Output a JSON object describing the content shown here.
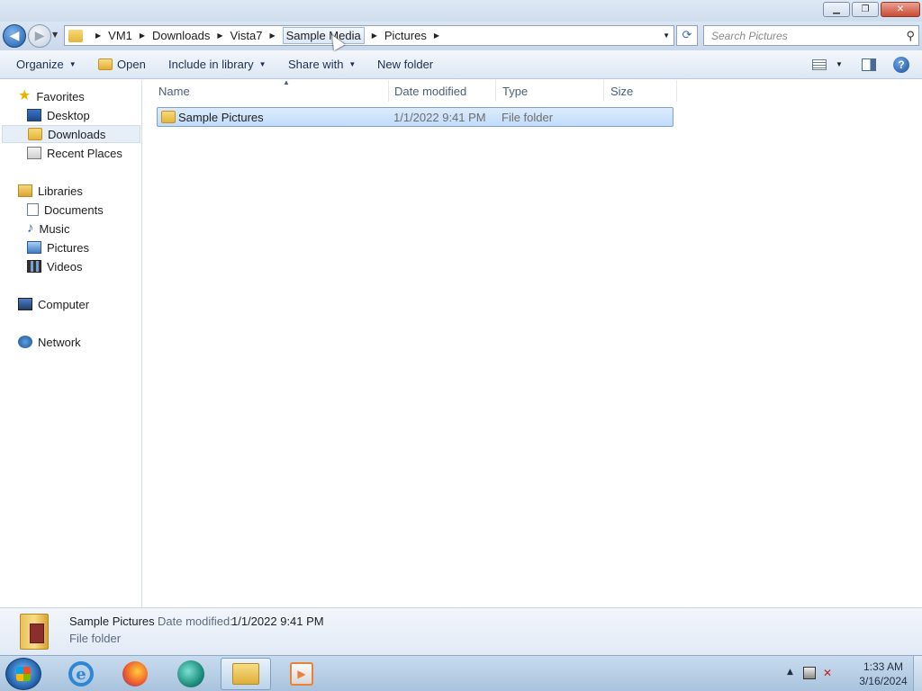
{
  "window": {
    "minimize_icon": "minimize-icon",
    "maximize_icon": "restore-icon",
    "close_icon": "close-icon"
  },
  "navigation": {
    "breadcrumb": [
      "VM1",
      "Downloads",
      "Vista7",
      "Sample Media",
      "Pictures"
    ],
    "search_placeholder": "Search Pictures"
  },
  "toolbar": {
    "organize": "Organize",
    "open": "Open",
    "include_in_library": "Include in library",
    "share_with": "Share with",
    "new_folder": "New folder"
  },
  "nav_pane": {
    "favorites": {
      "label": "Favorites",
      "items": [
        "Desktop",
        "Downloads",
        "Recent Places"
      ]
    },
    "libraries": {
      "label": "Libraries",
      "items": [
        "Documents",
        "Music",
        "Pictures",
        "Videos"
      ]
    },
    "computer": "Computer",
    "network": "Network",
    "selected": "Downloads"
  },
  "file_list": {
    "columns": [
      "Name",
      "Date modified",
      "Type",
      "Size"
    ],
    "rows": [
      {
        "name": "Sample Pictures",
        "date_modified": "1/1/2022 9:41 PM",
        "type": "File folder",
        "size": ""
      }
    ]
  },
  "details_pane": {
    "name": "Sample Pictures",
    "date_label": "Date modified:",
    "date_value": "1/1/2022 9:41 PM",
    "type": "File folder"
  },
  "taskbar": {
    "apps": [
      "internet-explorer",
      "firefox",
      "edge",
      "windows-explorer",
      "media-player"
    ],
    "time": "1:33 AM",
    "date": "3/16/2024"
  }
}
